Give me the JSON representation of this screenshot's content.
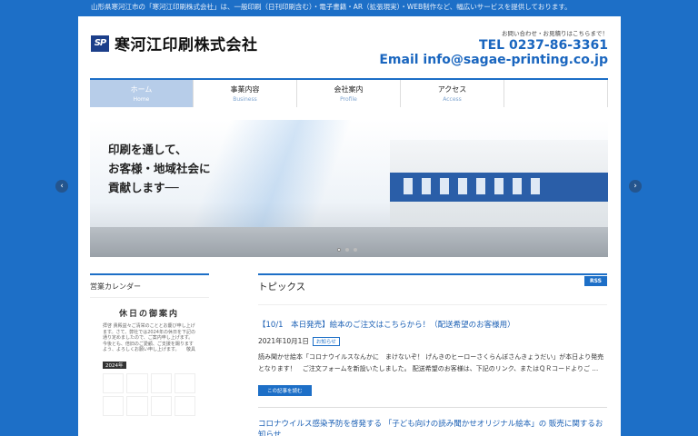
{
  "header": {
    "tagline": "山形県寒河江市の「寒河江印刷株式会社」は、一般印刷（日刊印刷含む）・電子書籍・AR（拡張現実）・WEB制作など、幅広いサービスを提供しております。",
    "logo_mark": "SP",
    "company_name": "寒河江印刷株式会社",
    "contact_note": "お問い合わせ・お見積りはこちらまで！",
    "tel": "TEL 0237-86-3361",
    "email": "Email   info@sagae-printing.co.jp"
  },
  "nav": {
    "items": [
      {
        "jp": "ホーム",
        "en": "Home"
      },
      {
        "jp": "事業内容",
        "en": "Business"
      },
      {
        "jp": "会社案内",
        "en": "Profile"
      },
      {
        "jp": "アクセス",
        "en": "Access"
      },
      {
        "jp": "",
        "en": ""
      }
    ]
  },
  "hero": {
    "lines": [
      "印刷を通して、",
      "お客様・地域社会に",
      "貢献します──"
    ],
    "prev_arrow": "‹",
    "next_arrow": "›"
  },
  "sidebar": {
    "title": "営業カレンダー",
    "calendar_heading": "休日の御案内",
    "calendar_text": "拝啓 貴殿益々ご清栄のこととお慶び申し上げます。さて、弊社では2024年の休日を下記の通り定めましたので、ご案内申し上げます。今後とも、倍旧のご愛顧、ご支援を賜りますよう、よろしくお願い申し上げます。　　敬具",
    "calendar_year": "2024年"
  },
  "main": {
    "topics_title": "トピックス",
    "rss_label": "RSS",
    "post1": {
      "title": "【10/1　本日発売】絵本のご注文はこちらから！（配送希望のお客様用）",
      "date": "2021年10月1日",
      "tag": "お知らせ",
      "body": "読み聞かせ絵本「コロナウイルスなんかに　まけないぞ！ げんきのヒーローさくらんぼさんきょうだい」が本日より発売となります！　ご注文フォームを新設いたしました。 配送希望のお客様は、下記のリンク、またはＱＲコードよりご …",
      "more_label": "この記事を読む"
    },
    "post2": {
      "title": "コロナウイルス感染予防を啓発する 「子ども向けの読み聞かせオリジナル絵本」の 販売に関するお知らせ"
    }
  },
  "colors": {
    "background": "#1d6fc7",
    "accent": "#1a66bf",
    "nav_active": "#b7cde9"
  }
}
